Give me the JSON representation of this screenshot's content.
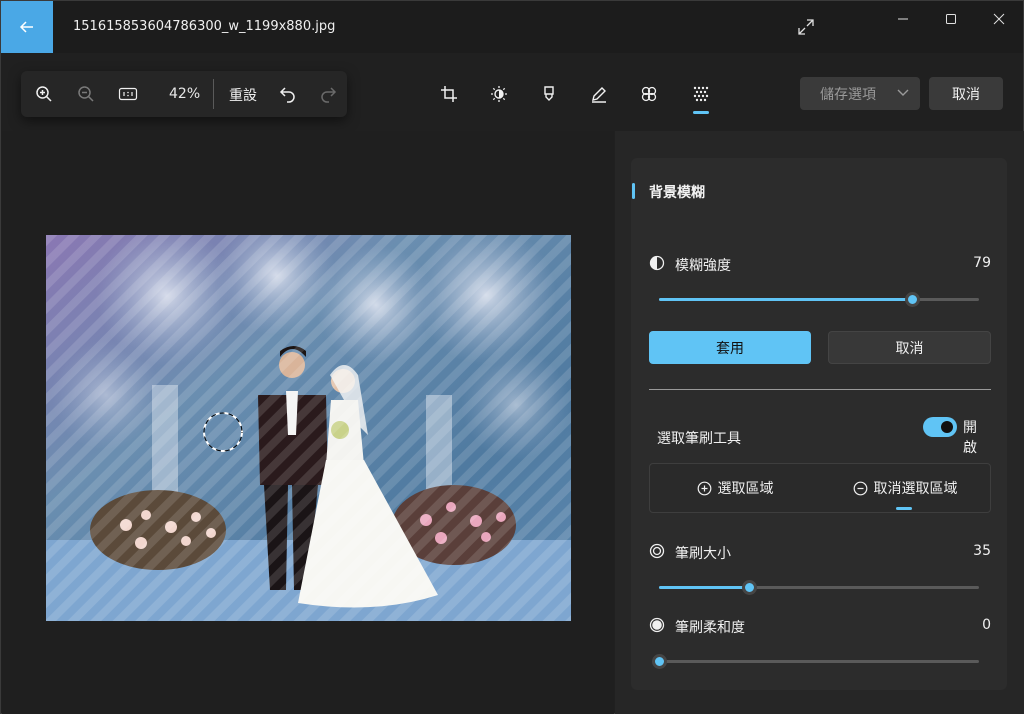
{
  "window": {
    "file_name": "151615853604786300_w_1199x880.jpg"
  },
  "icons": {
    "back": "arrow-left-icon",
    "expand": "expand-diagonal-icon",
    "minimize": "minimize-icon",
    "maximize": "maximize-icon",
    "close": "close-icon",
    "zoom_in": "zoom-in-icon",
    "zoom_out": "zoom-out-icon",
    "actual_size": "actual-size-icon",
    "undo": "undo-icon",
    "redo": "redo-icon",
    "crop": "crop-icon",
    "adjust": "brightness-icon",
    "markup": "highlighter-icon",
    "draw": "pen-icon",
    "filter": "filter-icon",
    "blur": "background-blur-icon",
    "chevron": "chevron-down-icon"
  },
  "toolbar": {
    "zoom_level": "42%",
    "reset_label": "重設",
    "save_options_label": "儲存選項",
    "cancel_label": "取消",
    "active_tool": "blur"
  },
  "panel": {
    "title": "背景模糊",
    "blur_strength": {
      "label": "模糊強度",
      "value": "79",
      "fraction": 0.79
    },
    "apply_label": "套用",
    "cancel_label": "取消",
    "brush_tool": {
      "label": "選取筆刷工具",
      "state": "開啟",
      "on": true
    },
    "select_area_label": "選取區域",
    "deselect_area_label": "取消選取區域",
    "brush_size": {
      "label": "筆刷大小",
      "value": "35",
      "fraction": 0.28
    },
    "brush_softness": {
      "label": "筆刷柔和度",
      "value": "0",
      "fraction": 0.0
    }
  },
  "colors": {
    "accent": "#60c4f5",
    "titlebar_back": "#4aa8e6",
    "background": "#202020",
    "panel": "#2c2c2c"
  }
}
